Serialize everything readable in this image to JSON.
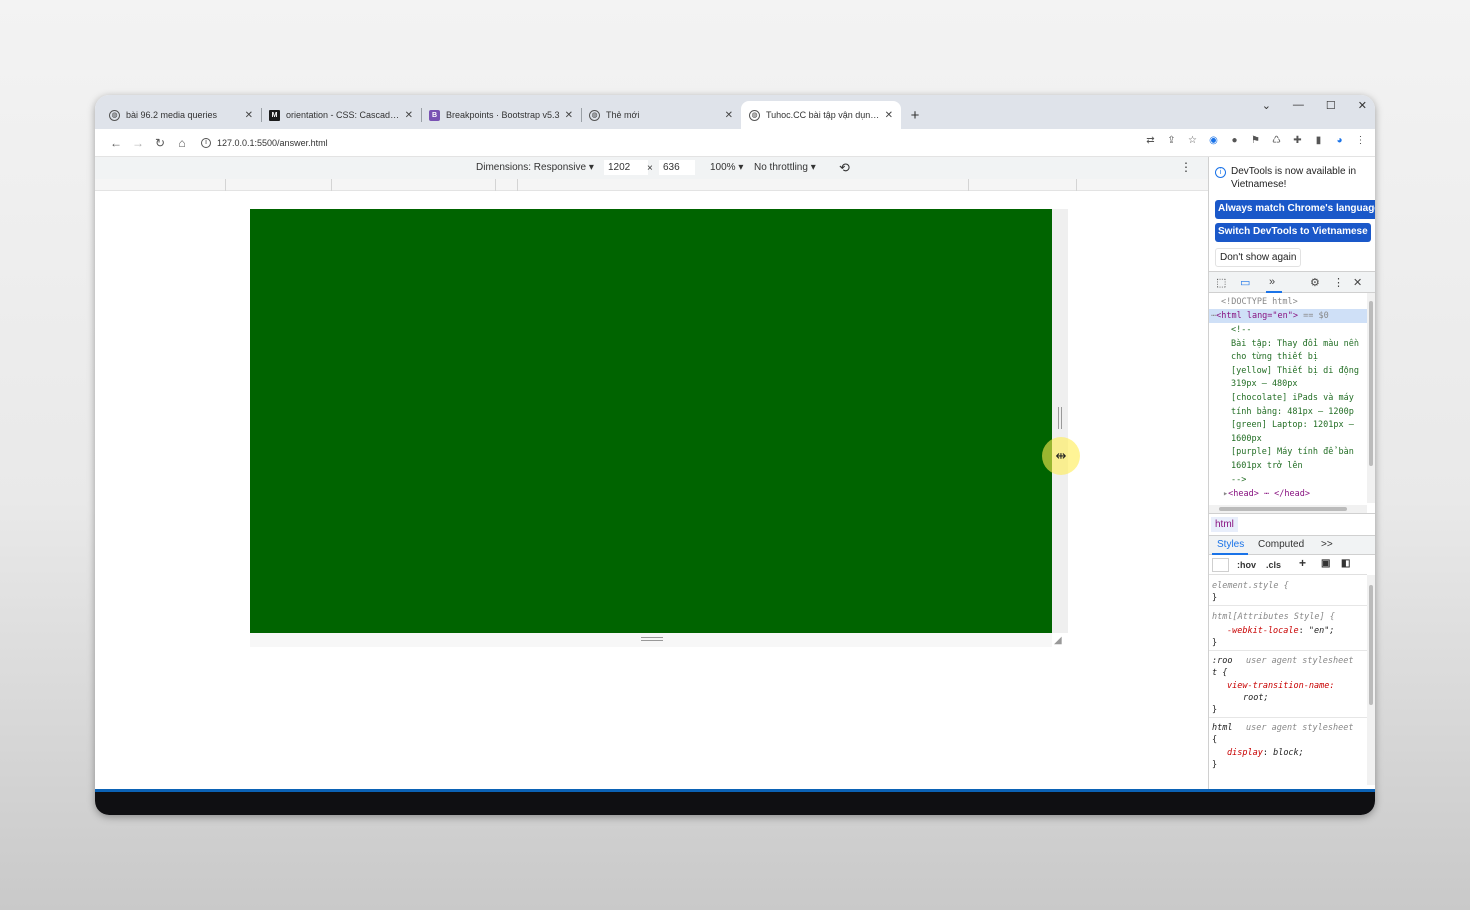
{
  "tabs": [
    {
      "title": "bài 96.2 media queries",
      "icon": "globe-icon",
      "active": false
    },
    {
      "title": "orientation - CSS: Cascading Sty",
      "icon": "mdn-icon",
      "active": false
    },
    {
      "title": "Breakpoints · Bootstrap v5.3",
      "icon": "bootstrap-icon",
      "active": false
    },
    {
      "title": "Thẻ mới",
      "icon": "globe-icon",
      "active": false
    },
    {
      "title": "Tuhoc.CC bài tập vận dụng Me",
      "icon": "globe-icon",
      "active": true
    }
  ],
  "address": {
    "url": "127.0.0.1:5500/answer.html"
  },
  "device_toolbar": {
    "dimensions_label": "Dimensions: Responsive ▾",
    "width": "1202",
    "times": "×",
    "height": "636",
    "zoom": "100% ▾",
    "throttle": "No throttling ▾"
  },
  "page": {
    "background_color": "#006400"
  },
  "devtools": {
    "notice": "DevTools is now available in Vietnamese!",
    "btn_match": "Always match Chrome's language",
    "btn_switch": "Switch DevTools to Vietnamese",
    "btn_dont_show": "Don't show again",
    "elements": {
      "doctype": "<!DOCTYPE html>",
      "html_open": "<html lang=\"en\">",
      "html_sel": "== $0",
      "comment_lines": [
        "<!--",
        "Bài tập: Thay đổi màu nền",
        "cho từng thiết bị",
        "[yellow] Thiết bị di động",
        "319px — 480px",
        "[chocolate] iPads và máy",
        "tính bảng: 481px — 1200p",
        "[green] Laptop: 1201px —",
        "1600px",
        "[purple] Máy tính để bàn",
        "1601px trở lên",
        "-->"
      ],
      "head": "<head> ⋯ </head>"
    },
    "breadcrumb": "html",
    "styles_tab": "Styles",
    "computed_tab": "Computed",
    "more_tabs": ">>",
    "hov": ":hov",
    "cls": ".cls",
    "rules": {
      "element_style": "element.style {",
      "attr_selector": "html[Attributes Style] {",
      "locale_prop": "-webkit-locale",
      "locale_val": "\"en\";",
      "root_sel_a": ":roo",
      "root_sel_b": "t {",
      "ua": "user agent stylesheet",
      "vt_prop": "view-transition-name",
      "vt_val": "root;",
      "html_sel": "html",
      "brace_open": "{",
      "display_prop": "display",
      "display_val": "block;",
      "close": "}"
    }
  }
}
